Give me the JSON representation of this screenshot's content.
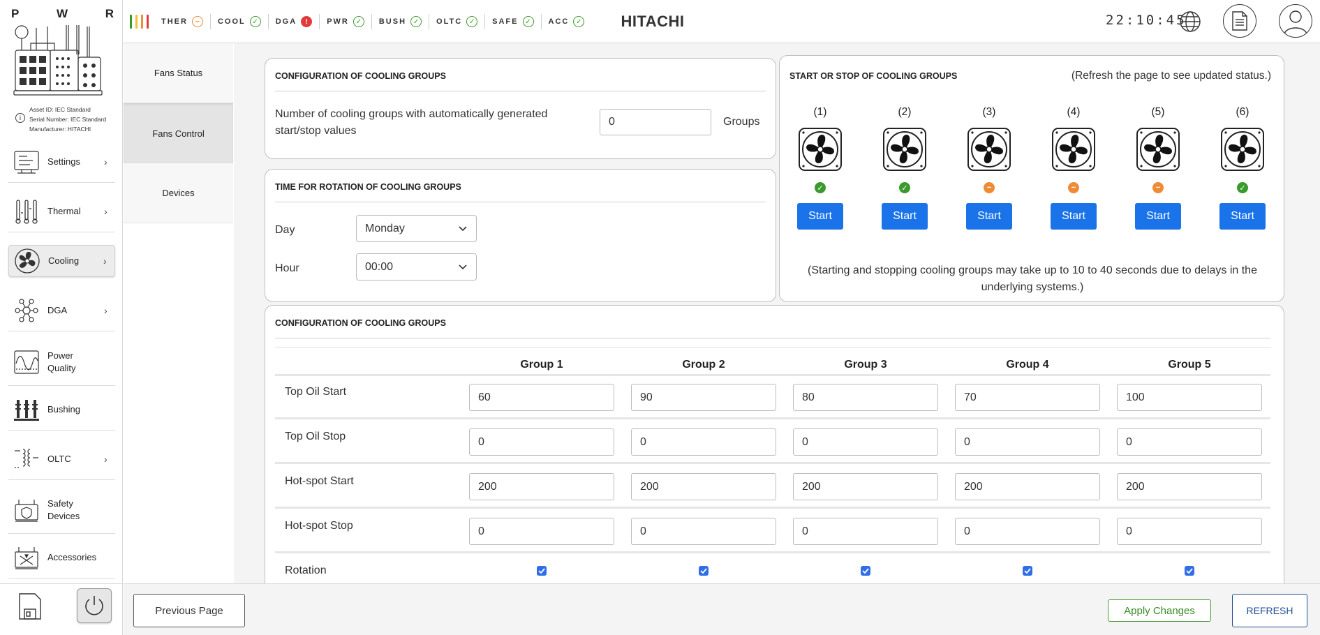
{
  "header": {
    "asset_letters": [
      "P",
      "W",
      "R"
    ],
    "bar_colors": [
      "#3a9a2c",
      "#f2c12e",
      "#ef8a35",
      "#e33b3b"
    ],
    "status_items": [
      {
        "label": "THER",
        "state": "warn",
        "icon": "minus-icon",
        "glyph": "−"
      },
      {
        "label": "COOL",
        "state": "ok",
        "icon": "check-icon",
        "glyph": "✓"
      },
      {
        "label": "DGA",
        "state": "error",
        "icon": "exclamation-icon",
        "glyph": "!"
      },
      {
        "label": "PWR",
        "state": "ok",
        "icon": "check-icon",
        "glyph": "✓"
      },
      {
        "label": "BUSH",
        "state": "ok",
        "icon": "check-icon",
        "glyph": "✓"
      },
      {
        "label": "OLTC",
        "state": "ok",
        "icon": "check-icon",
        "glyph": "✓"
      },
      {
        "label": "SAFE",
        "state": "ok",
        "icon": "check-icon",
        "glyph": "✓"
      },
      {
        "label": "ACC",
        "state": "ok",
        "icon": "check-icon",
        "glyph": "✓"
      }
    ],
    "brand": "HITACHI",
    "clock": "22:10:45"
  },
  "asset_info": {
    "asset_id": "Asset ID: IEC Standard",
    "serial": "Serial Number: IEC Standard",
    "manufacturer": "Manufacturer: HITACHI"
  },
  "sidebar": {
    "items": [
      {
        "label": "Settings",
        "icon": "settings-icon",
        "chevron": true,
        "active": false
      },
      {
        "label": "Thermal",
        "icon": "thermometer-icon",
        "chevron": true,
        "active": false
      },
      {
        "label": "Cooling",
        "icon": "fan-icon",
        "chevron": true,
        "active": true
      },
      {
        "label": "DGA",
        "icon": "molecule-icon",
        "chevron": true,
        "active": false
      },
      {
        "label": "Power Quality",
        "icon": "waveform-icon",
        "chevron": false,
        "active": false
      },
      {
        "label": "Bushing",
        "icon": "bushing-icon",
        "chevron": false,
        "active": false
      },
      {
        "label": "OLTC",
        "icon": "tap-changer-icon",
        "chevron": true,
        "active": false
      },
      {
        "label": "Safety Devices",
        "icon": "safety-icon",
        "chevron": false,
        "active": false
      },
      {
        "label": "Accessories",
        "icon": "accessories-icon",
        "chevron": false,
        "active": false
      }
    ]
  },
  "subnav": {
    "items": [
      {
        "label": "Fans Status",
        "active": false
      },
      {
        "label": "Fans Control",
        "active": true
      },
      {
        "label": "Devices",
        "active": false
      }
    ]
  },
  "config_card": {
    "title": "CONFIGURATION OF COOLING GROUPS",
    "description": "Number of cooling groups with automatically generated start/stop values",
    "value": "0",
    "unit": "Groups"
  },
  "rotation_card": {
    "title": "TIME FOR ROTATION OF COOLING GROUPS",
    "day_label": "Day",
    "day_value": "Monday",
    "hour_label": "Hour",
    "hour_value": "00:00"
  },
  "start_card": {
    "title": "START OR STOP OF COOLING GROUPS",
    "hint": "(Refresh the page to see updated status.)",
    "note": "(Starting and stopping cooling groups may take up to 10 to 40 seconds due to delays in the underlying systems.)",
    "groups": [
      {
        "num": "(1)",
        "status": "ok",
        "button": "Start"
      },
      {
        "num": "(2)",
        "status": "ok",
        "button": "Start"
      },
      {
        "num": "(3)",
        "status": "warn",
        "button": "Start"
      },
      {
        "num": "(4)",
        "status": "warn",
        "button": "Start"
      },
      {
        "num": "(5)",
        "status": "warn",
        "button": "Start"
      },
      {
        "num": "(6)",
        "status": "ok",
        "button": "Start"
      }
    ],
    "status_colors": {
      "ok": "#3a9a2c",
      "warn": "#ef8a35"
    }
  },
  "table_card": {
    "title": "CONFIGURATION OF COOLING GROUPS",
    "columns": [
      "Group 1",
      "Group 2",
      "Group 3",
      "Group 4",
      "Group 5"
    ],
    "rows": [
      {
        "label": "Top Oil Start",
        "values": [
          "60",
          "90",
          "80",
          "70",
          "100"
        ]
      },
      {
        "label": "Top Oil Stop",
        "values": [
          "0",
          "0",
          "0",
          "0",
          "0"
        ]
      },
      {
        "label": "Hot-spot Start",
        "values": [
          "200",
          "200",
          "200",
          "200",
          "200"
        ]
      },
      {
        "label": "Hot-spot Stop",
        "values": [
          "0",
          "0",
          "0",
          "0",
          "0"
        ]
      }
    ],
    "rotation_label": "Rotation",
    "rotation_checked": [
      true,
      true,
      true,
      true,
      true
    ]
  },
  "footer": {
    "prev_label": "Previous Page",
    "apply_label": "Apply Changes",
    "refresh_label": "REFRESH"
  },
  "colors": {
    "primary_button": "#1a73e8",
    "apply": "#3a8a24",
    "refresh": "#1f4e96"
  }
}
